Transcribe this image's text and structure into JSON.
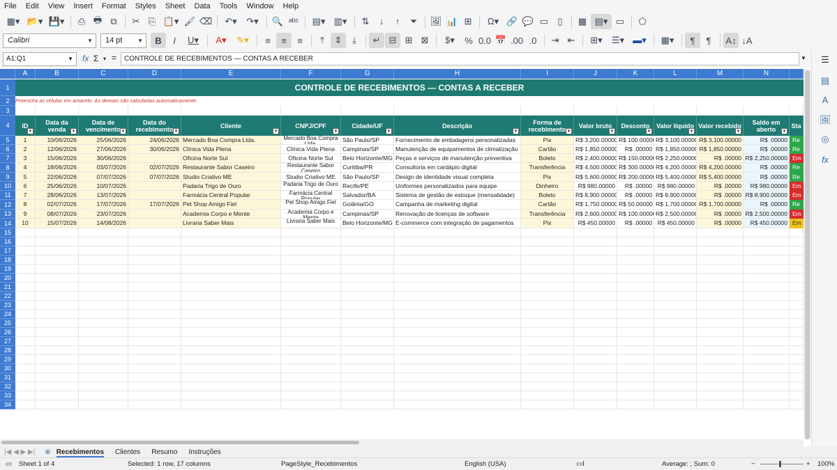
{
  "menu": [
    "File",
    "Edit",
    "View",
    "Insert",
    "Format",
    "Styles",
    "Sheet",
    "Data",
    "Tools",
    "Window",
    "Help"
  ],
  "toolbar": {
    "font_name": "Calibri",
    "font_size": "14 pt"
  },
  "formula": {
    "name_box": "A1:Q1",
    "fx": "fx",
    "sigma": "Σ",
    "equals": "=",
    "content": "CONTROLE DE RECEBIMENTOS — CONTAS A RECEBER"
  },
  "columns": [
    "A",
    "B",
    "C",
    "D",
    "E",
    "F",
    "G",
    "H",
    "I",
    "J",
    "K",
    "L",
    "M",
    "N"
  ],
  "sheet": {
    "title": "CONTROLE DE RECEBIMENTOS — CONTAS A RECEBER",
    "note": "Preencha as células em amarelo. As demais são calculadas automaticamente.",
    "headers": [
      "ID",
      "Data da venda",
      "Data de vencimento",
      "Data do recebimento",
      "Cliente",
      "CNPJ/CPF",
      "Cidade/UF",
      "Descrição",
      "Forma de recebimento",
      "Valor bruto",
      "Desconto",
      "Valor líquido",
      "Valor recebido",
      "Saldo em aberto",
      "Sta"
    ],
    "rows": [
      [
        "1",
        "10/06/2026",
        "25/06/2026",
        "24/06/2026",
        "Mercado Boa Compra Ltda.",
        "Mercado Boa Compra Ltda.",
        "São Paulo/SP",
        "Fornecimento de embalagens personalizadas",
        "Pix",
        "R$ 3,200.00000",
        "R$ 100.00000",
        "R$ 3,100.00000",
        "R$ 3,100.00000",
        "R$ .00000",
        "Re"
      ],
      [
        "2",
        "12/06/2026",
        "27/06/2026",
        "30/06/2026",
        "Clínica Vida Plena",
        "Clínica Vida Plena",
        "Campinas/SP",
        "Manutenção de equipamentos de climatização",
        "Cartão",
        "R$ 1,850.00000",
        "R$ .00000",
        "R$ 1,850.00000",
        "R$ 1,850.00000",
        "R$ .00000",
        "Re"
      ],
      [
        "3",
        "15/06/2026",
        "30/06/2026",
        "",
        "Oficina Norte Sul",
        "Oficina Norte Sul",
        "Belo Horizonte/MG",
        "Peças e serviços de manutenção preventiva",
        "Boleto",
        "R$ 2,400.00000",
        "R$ 150.00000",
        "R$ 2,250.00000",
        "R$ .00000",
        "R$ 2,250.00000",
        "Em"
      ],
      [
        "4",
        "18/06/2026",
        "03/07/2026",
        "02/07/2026",
        "Restaurante Sabor Caseiro",
        "Restaurante Sabor Caseiro",
        "Curitiba/PR",
        "Consultoria em cardápio digital",
        "Transferência",
        "R$ 4,500.00000",
        "R$ 300.00000",
        "R$ 4,200.00000",
        "R$ 4,200.00000",
        "R$ .00000",
        "Re"
      ],
      [
        "5",
        "22/06/2026",
        "07/07/2026",
        "07/07/2026",
        "Studio Criativo ME",
        "Studio Criativo ME",
        "São Paulo/SP",
        "Design de identidade visual completa",
        "Pix",
        "R$ 5,600.00000",
        "R$ 200.00000",
        "R$ 5,400.00000",
        "R$ 5,400.00000",
        "R$ .00000",
        "Re"
      ],
      [
        "6",
        "25/06/2026",
        "10/07/2026",
        "",
        "Padaria Trigo de Ouro",
        "Padaria Trigo de Ouro",
        "Recife/PE",
        "Uniformes personalizados para equipe",
        "Dinheiro",
        "R$ 980.00000",
        "R$ .00000",
        "R$ 980.00000",
        "R$ .00000",
        "R$ 980.00000",
        "Em"
      ],
      [
        "7",
        "28/06/2026",
        "13/07/2026",
        "",
        "Farmácia Central Popular",
        "Farmácia Central Popular",
        "Salvador/BA",
        "Sistema de gestão de estoque (mensalidade)",
        "Boleto",
        "R$ 8,900.00000",
        "R$ .00000",
        "R$ 8,900.00000",
        "R$ .00000",
        "R$ 8,900.00000",
        "Em"
      ],
      [
        "8",
        "02/07/2026",
        "17/07/2026",
        "17/07/2026",
        "Pet Shop Amigo Fiel",
        "Pet Shop Amigo Fiel",
        "Goiânia/GO",
        "Campanha de marketing digital",
        "Cartão",
        "R$ 1,750.00000",
        "R$ 50.00000",
        "R$ 1,700.00000",
        "R$ 1,700.00000",
        "R$ .00000",
        "Re"
      ],
      [
        "9",
        "08/07/2026",
        "23/07/2026",
        "",
        "Academia Corpo e Mente",
        "Academia Corpo e Mente",
        "Campinas/SP",
        "Renovação de licenças de software",
        "Transferência",
        "R$ 2,600.00000",
        "R$ 100.00000",
        "R$ 2,500.00000",
        "R$ .00000",
        "R$ 2,500.00000",
        "Em"
      ],
      [
        "10",
        "15/07/2026",
        "14/08/2026",
        "",
        "Livraria Saber Mais",
        "Livraria Saber Mais",
        "Belo Horizonte/MG",
        "E-commerce com integração de pagamentos",
        "Pix",
        "R$ 450.00000",
        "R$ .00000",
        "R$ 450.00000",
        "R$ .00000",
        "R$ 450.00000",
        "Em"
      ]
    ],
    "row_numbers": [
      "1",
      "2",
      "3",
      "4",
      "5",
      "6",
      "7",
      "8",
      "9",
      "10",
      "11",
      "12",
      "13",
      "14",
      "15",
      "16",
      "17",
      "18",
      "19",
      "20",
      "21",
      "22",
      "23",
      "24",
      "25",
      "26",
      "27",
      "28",
      "29",
      "30",
      "31",
      "32",
      "33",
      "34"
    ]
  },
  "status_colors": {
    "Re": "#2aa84a",
    "Em": "#d92b2b",
    "Em_last": "#f0c419"
  },
  "tabs": [
    "Recebimentos",
    "Clientes",
    "Resumo",
    "Instruções"
  ],
  "status": {
    "sheet": "Sheet 1 of 4",
    "selection": "Selected: 1 row, 17 columns",
    "page_style": "PageStyle_Recebimentos",
    "language": "English (USA)",
    "calc": "Average: ; Sum: 0",
    "zoom": "100%"
  }
}
